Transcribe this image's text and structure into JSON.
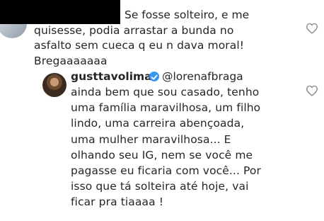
{
  "comments": [
    {
      "username_hidden": true,
      "first_line": "Se fosse solteiro, e me",
      "rest": "quisesse, podia arrastar a bunda no\nasfalto sem cueca q eu n dava moral!\nBregaaaaaaa",
      "heart_icon": "heart-outline-icon"
    },
    {
      "username": "gusttavolima",
      "verified_icon": "verified-badge-icon",
      "mention": "@lorenafbraga",
      "text": "ainda bem que sou casado, tenho\numa família maravilhosa, um filho\nlindo, uma carreira  abençoada,\numa mulher maravilhosa... E\nolhando seu IG, nem se você me\npagasse eu ficaria com você... Por\nisso que tá solteira até hoje, vai\nficar pra tiaaaa !",
      "heart_icon": "heart-outline-icon"
    }
  ],
  "colors": {
    "text": "#262626",
    "verified": "#3897f0",
    "heart": "#8e8e8e"
  }
}
